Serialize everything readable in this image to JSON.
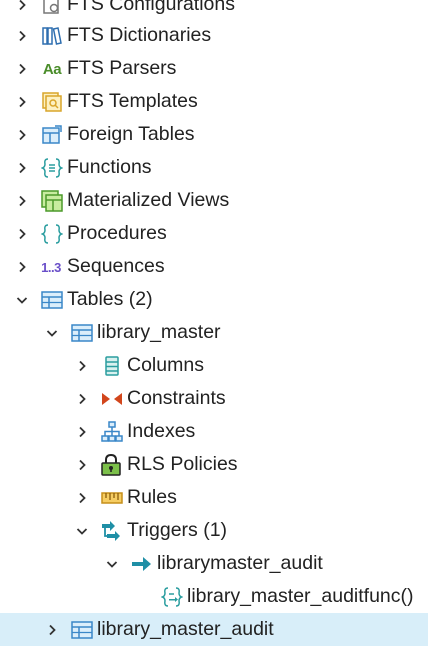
{
  "tree": {
    "items": [
      {
        "label": "FTS Configurations",
        "icon": "fts-configurations-icon",
        "expanded": false
      },
      {
        "label": "FTS Dictionaries",
        "icon": "fts-dictionaries-icon",
        "expanded": false
      },
      {
        "label": "FTS Parsers",
        "icon": "fts-parsers-icon",
        "icon_text": "Aa",
        "expanded": false
      },
      {
        "label": "FTS Templates",
        "icon": "fts-templates-icon",
        "expanded": false
      },
      {
        "label": "Foreign Tables",
        "icon": "foreign-tables-icon",
        "expanded": false
      },
      {
        "label": "Functions",
        "icon": "functions-icon",
        "expanded": false
      },
      {
        "label": "Materialized Views",
        "icon": "materialized-views-icon",
        "expanded": false
      },
      {
        "label": "Procedures",
        "icon": "procedures-icon",
        "expanded": false
      },
      {
        "label": "Sequences",
        "icon": "sequences-icon",
        "icon_text": "1..3",
        "expanded": false
      },
      {
        "label": "Tables (2)",
        "icon": "tables-icon",
        "expanded": true
      },
      {
        "label": "library_master",
        "icon": "table-icon",
        "expanded": true
      },
      {
        "label": "Columns",
        "icon": "columns-icon",
        "expanded": false
      },
      {
        "label": "Constraints",
        "icon": "constraints-icon",
        "expanded": false
      },
      {
        "label": "Indexes",
        "icon": "indexes-icon",
        "expanded": false
      },
      {
        "label": "RLS Policies",
        "icon": "rls-policies-icon",
        "expanded": false
      },
      {
        "label": "Rules",
        "icon": "rules-icon",
        "expanded": false
      },
      {
        "label": "Triggers (1)",
        "icon": "triggers-icon",
        "expanded": true
      },
      {
        "label": "librarymaster_audit",
        "icon": "trigger-icon",
        "expanded": true
      },
      {
        "label": "library_master_auditfunc()",
        "icon": "trigger-function-icon",
        "expanded": null
      },
      {
        "label": "library_master_audit",
        "icon": "table-icon",
        "expanded": false,
        "selected": true
      }
    ]
  },
  "colors": {
    "selected_bg": "#d8eef9",
    "chevron": "#333333",
    "table_blue": "#3a87c8",
    "function_teal": "#2a9d9f",
    "rls_green": "#4c9a2a",
    "rules_yellow": "#e8b74a",
    "triggers_teal": "#1f8fa6",
    "constraint_red": "#d2461c"
  }
}
